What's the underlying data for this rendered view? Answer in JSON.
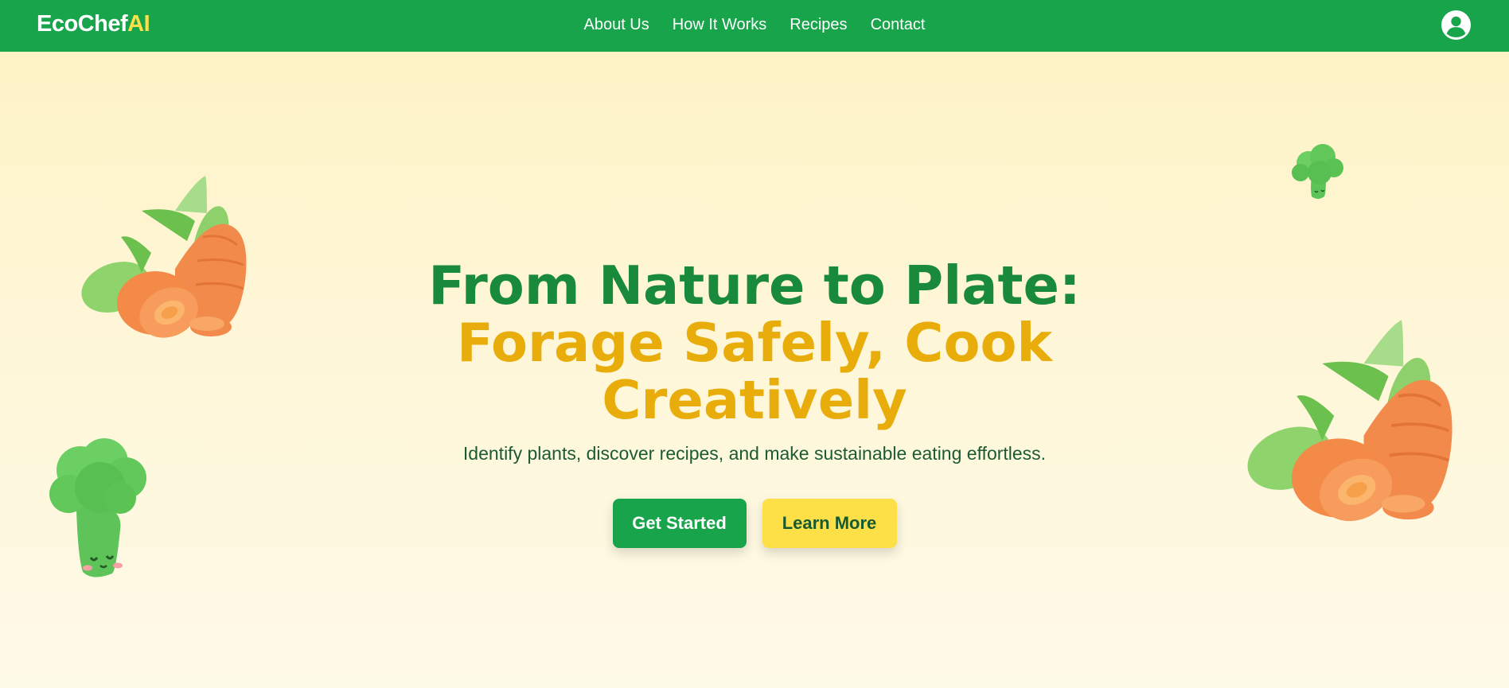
{
  "brand": {
    "name_part1": "EcoChef",
    "name_part2": "AI"
  },
  "nav": {
    "items": [
      "About Us",
      "How It Works",
      "Recipes",
      "Contact"
    ]
  },
  "hero": {
    "title_line1": "From Nature to Plate:",
    "title_line2": "Forage Safely, Cook",
    "title_line3": "Creatively",
    "subtitle": "Identify plants, discover recipes, and make sustainable eating effortless.",
    "primary_button": "Get Started",
    "secondary_button": "Learn More"
  },
  "icons": {
    "user": "user-circle-icon",
    "decorations": [
      "carrot-illustration",
      "broccoli-illustration"
    ]
  },
  "colors": {
    "nav_bg": "#18a44b",
    "brand_accent": "#fde047",
    "title_green": "#198a3c",
    "title_gold": "#e8ad0b",
    "hero_bg": "#fef4cc"
  }
}
